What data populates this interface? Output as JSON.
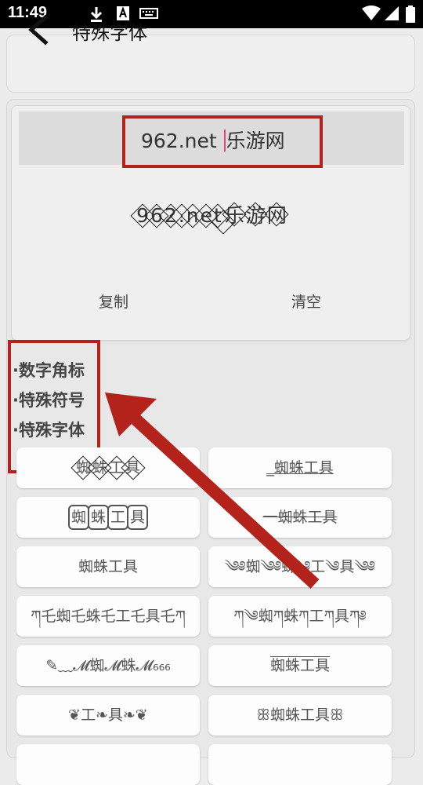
{
  "status": {
    "time": "11:49"
  },
  "header": {
    "title": "特殊字体"
  },
  "input": {
    "value_left": "962.net ",
    "value_right": "乐游网"
  },
  "preview": {
    "styled_text": "962.net 乐游网"
  },
  "actions": {
    "copy": "复制",
    "clear": "清空"
  },
  "categories": [
    "·数字角标",
    "·特殊符号",
    "·特殊字体"
  ],
  "fonts": [
    "蜘蛛工具",
    "_蜘蛛工具",
    "蜘蛛工具",
    "一蜘蛛工具",
    "蜘蛛工具",
    "༄༅蜘༄༅蛛༄工༄具༄༅",
    "ཀ乇蜘乇蛛乇工乇具乇ཀ",
    "ཀ༄蜘ཀ蛛ཀ工ཀ具ཀ༅",
    "✎﹏𝓜蜘𝓜蛛𝓜₆₆₆",
    "蜘蛛工具",
    "❦工❧具❧❦",
    "ꕥ蜘蛛工具ꕥ"
  ]
}
